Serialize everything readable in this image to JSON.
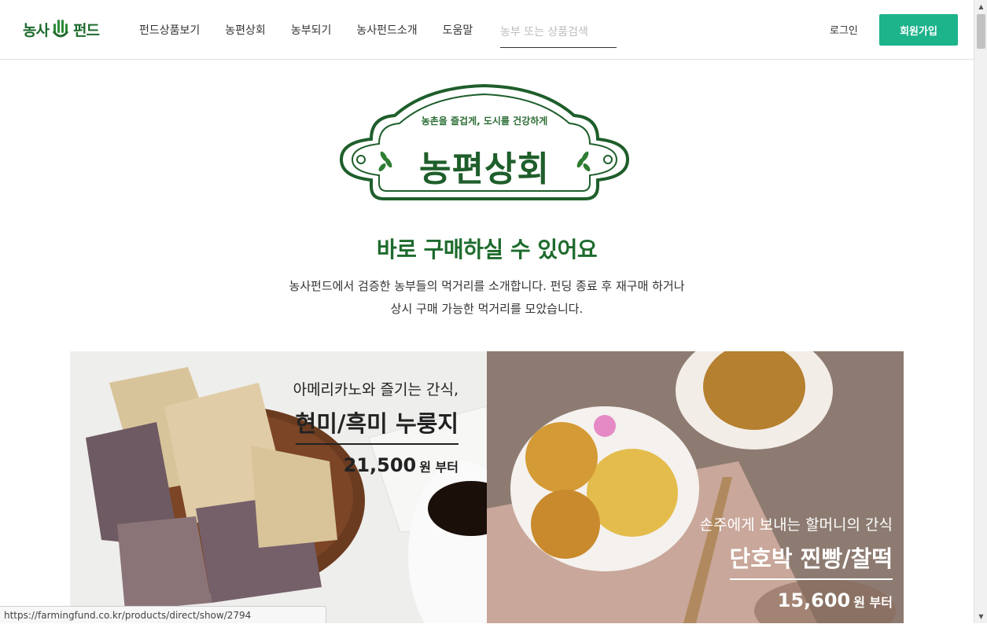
{
  "header": {
    "logo_left": "농사",
    "logo_right": "펀드",
    "nav": [
      "펀드상품보기",
      "농편상회",
      "농부되기",
      "농사펀드소개",
      "도움말"
    ],
    "search_placeholder": "농부 또는 상품검색",
    "login": "로그인",
    "signup": "회원가입"
  },
  "emblem": {
    "slogan": "농촌을 즐겁게, 도시를 건강하게",
    "title": "농편상회"
  },
  "intro": {
    "headline": "바로 구매하실 수 있어요",
    "line1": "농사펀드에서 검증한 농부들의 먹거리를 소개합니다. 펀딩 종료 후 재구매 하거나",
    "line2": "상시 구매 가능한 먹거리를 모았습니다."
  },
  "products": [
    {
      "subtitle": "아메리카노와 즐기는 간식,",
      "name": "현미/흑미 누룽지",
      "price": "21,500",
      "unit": "원 부터"
    },
    {
      "subtitle": "손주에게 보내는 할머니의 간식",
      "name": "단호박 찐빵/찰떡",
      "price": "15,600",
      "unit": "원 부터"
    }
  ],
  "status_url": "https://farmingfund.co.kr/products/direct/show/2794",
  "colors": {
    "brand_green": "#1e6b2d",
    "signup_bg": "#1db38b"
  },
  "icons": {
    "logo": "hand-sprout-icon",
    "scroll_up": "scroll-up-arrow",
    "scroll_down": "scroll-down-arrow"
  }
}
